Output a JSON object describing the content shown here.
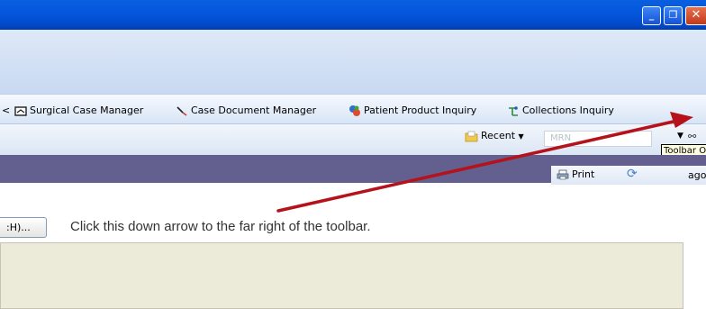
{
  "window": {
    "min_glyph": "_",
    "restore_glyph": "❐",
    "close_glyph": "✕"
  },
  "toolbar": {
    "items": [
      {
        "label": "Surgical Case Manager",
        "icon": "surgical-case-icon"
      },
      {
        "label": "Case Document Manager",
        "icon": "case-document-icon"
      },
      {
        "label": "Patient Product Inquiry",
        "icon": "patient-product-icon"
      },
      {
        "label": "Collections Inquiry",
        "icon": "collections-icon"
      }
    ],
    "leading_fragment": "<"
  },
  "search": {
    "recent_label": "Recent",
    "placeholder": "MRN"
  },
  "tooltip": {
    "text": "Toolbar Options"
  },
  "actions": {
    "print_label": "Print",
    "ago_fragment": "ago"
  },
  "content": {
    "left_button_fragment": ":H)...",
    "instruction": "Click this down arrow to the far right of the toolbar."
  },
  "colors": {
    "title_blue": "#0457dd",
    "purple_bar": "#635f8f",
    "annotation_arrow": "#b5121b"
  }
}
